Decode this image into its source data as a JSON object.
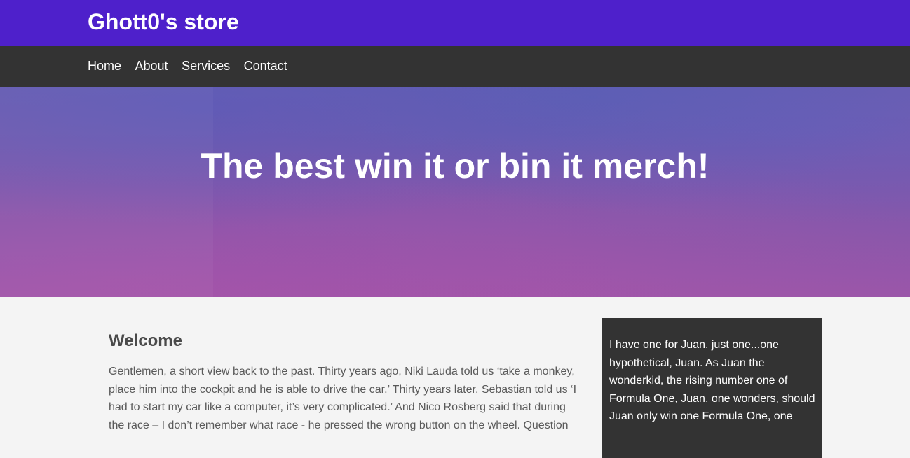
{
  "header": {
    "title": "Ghott0's store"
  },
  "nav": {
    "items": [
      "Home",
      "About",
      "Services",
      "Contact"
    ]
  },
  "hero": {
    "heading": "The best win it or bin it merch!"
  },
  "main": {
    "heading": "Welcome",
    "paragraph": "Gentlemen, a short view back to the past. Thirty years ago, Niki Lauda told us ‘take a monkey, place him into the cockpit and he is able to drive the car.’ Thirty years later, Sebastian told us ‘I had to start my car like a computer, it’s very complicated.’ And Nico Rosberg said that during the race – I don’t remember what race - he pressed the wrong button on the wheel. Question"
  },
  "sidebar": {
    "text": "I have one for Juan, just one...one hypothetical, Juan. As Juan the wonderkid, the rising number one of Formula One, Juan, one wonders, should Juan only win one Formula One, one"
  },
  "colors": {
    "header_bg": "#4e20cb",
    "nav_bg": "#333333",
    "page_bg": "#f4f4f4",
    "sidebar_bg": "#333333"
  }
}
